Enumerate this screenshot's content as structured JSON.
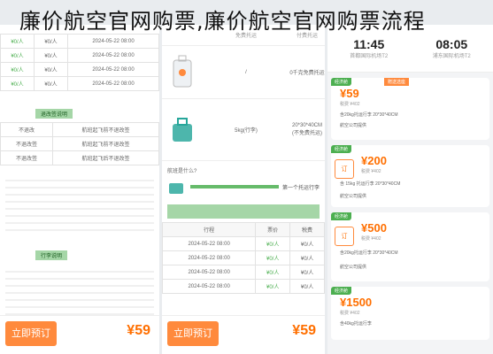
{
  "headline": "廉价航空官网购票,廉价航空官网购票流程",
  "left": {
    "table_rows": [
      [
        "¥0/人",
        "¥0/人",
        "2024-05-22 08:00"
      ],
      [
        "¥0/人",
        "¥0/人",
        "2024-05-22 08:00"
      ],
      [
        "¥0/人",
        "¥0/人",
        "2024-05-22 08:00"
      ],
      [
        "¥0/人",
        "¥0/人",
        "2024-05-22 08:00"
      ]
    ],
    "section1_title": "退改签说明",
    "policy_rows": [
      [
        "不退改",
        "航班起飞前不退改签"
      ],
      [
        "不退改签",
        "航班起飞前不退改签"
      ],
      [
        "不退改签",
        "航班起飞后不退改签"
      ]
    ],
    "section2_title": "行李说明",
    "footer_price": "¥59",
    "footer_button": "立即预订"
  },
  "middle": {
    "header_cols": [
      "免费托运",
      "付费托运"
    ],
    "luggage_rows": [
      {
        "col2": "/",
        "col3": "0千克免费托运"
      },
      {
        "col2": "5kg(行李)",
        "col3": "20*30*40CM\n(不免费托运)"
      }
    ],
    "hint": "航班是什么?",
    "bar_label": "第一个托运行李",
    "table_header": [
      "行程",
      "票价",
      "税费"
    ],
    "table_rows": [
      [
        "2024-05-22 08:00",
        "¥0/人",
        "¥0/人"
      ],
      [
        "2024-05-22 08:00",
        "¥0/人",
        "¥0/人"
      ],
      [
        "2024-05-22 08:00",
        "¥0/人",
        "¥0/人"
      ],
      [
        "2024-05-22 08:00",
        "¥0/人",
        "¥0/人"
      ]
    ],
    "footer_price": "¥59",
    "footer_button": "立即预订"
  },
  "right": {
    "depart_time": "11:45",
    "depart_sub": "首都国际机场T2",
    "arrive_time": "08:05",
    "arrive_sub": "浦东国际机场T2",
    "cards": [
      {
        "tag": "经济舱",
        "tag2": "赠送选座",
        "price": "¥59",
        "caption": "税费 ¥402",
        "line1": "含20kg托运行李 20*30*40CM",
        "line2": "航空公司提供"
      },
      {
        "tag": "经济舱",
        "tag2": "",
        "price": "¥200",
        "caption": "税费 ¥402",
        "line1": "含 15kg 托运行李 20*30*40CM",
        "line2": "航空公司提供"
      },
      {
        "tag": "经济舱",
        "tag2": "",
        "price": "¥500",
        "caption": "税费 ¥402",
        "line1": "含20kg托运行李 20*30*40CM",
        "line2": "航空公司提供"
      },
      {
        "tag": "经济舱",
        "tag2": "",
        "price": "¥1500",
        "caption": "税费 ¥402",
        "line1": "含40kg托运行李",
        "line2": "航空公司提供"
      }
    ],
    "chip_label": "订"
  },
  "colors": {
    "accent_orange": "#ff8a3d",
    "accent_green": "#4caf50"
  }
}
